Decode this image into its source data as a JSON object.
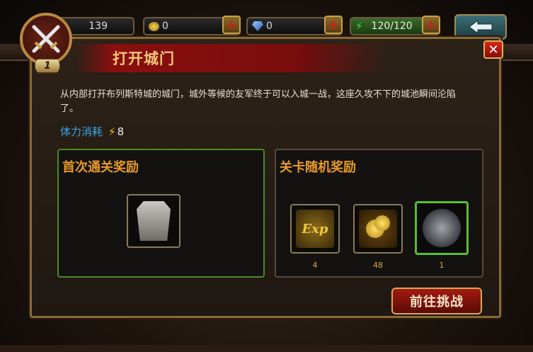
{
  "hud": {
    "power": "139",
    "gold": "0",
    "gems": "0",
    "stamina": "120/120",
    "plus_label": "+",
    "level_badge": "1"
  },
  "dialog": {
    "title": "打开城门",
    "close_label": "✕",
    "description": "从内部打开布列斯特城的城门，城外等候的友军终于可以入城一战，这座久攻不下的城池瞬间沦陷了。",
    "stamina_label": "体力消耗",
    "stamina_cost": "8",
    "first_clear": {
      "title": "首次通关奖励",
      "items": [
        {
          "icon": "armor-icon"
        }
      ]
    },
    "random_rewards": {
      "title": "关卡随机奖励",
      "items": [
        {
          "icon": "exp-icon",
          "label": "Exp",
          "count": "4"
        },
        {
          "icon": "gold-coins-icon",
          "count": "48"
        },
        {
          "icon": "stone-orb-icon",
          "count": "1"
        }
      ]
    },
    "go_button": "前往挑战"
  },
  "colors": {
    "accent_gold": "#e89a2a",
    "stamina_blue": "#35a8e6",
    "frame_green": "#59c02c",
    "button_red": "#a31a12"
  }
}
